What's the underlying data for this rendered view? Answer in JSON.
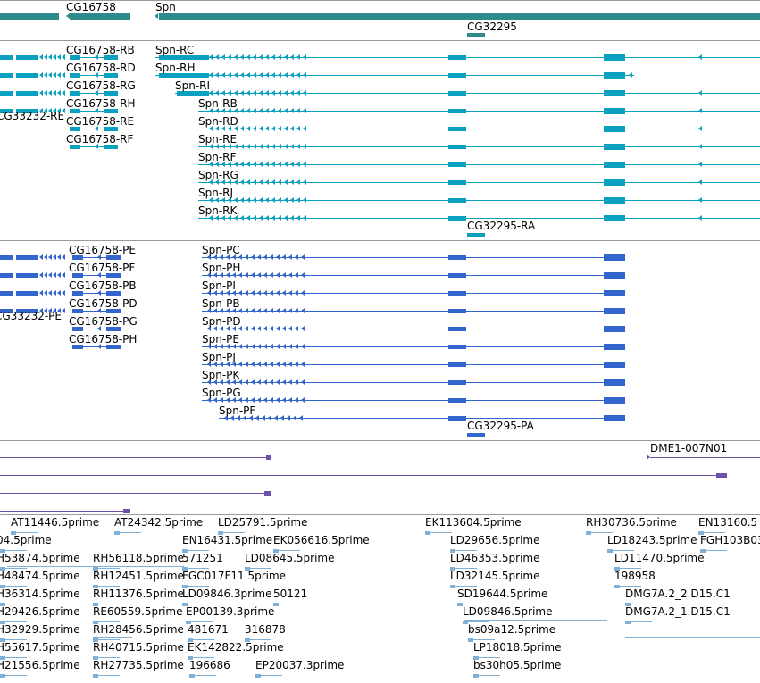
{
  "colors": {
    "gene": "#2e8b8b",
    "transcript": "#0aa1c0",
    "protein": "#3366cc",
    "cdna": "#6b52a8",
    "est": "#7eb0d8",
    "separator": "#9a9a9a"
  },
  "genes": {
    "cg16758": "CG16758",
    "spn": "Spn",
    "cg32295": "CG32295"
  },
  "transcripts": {
    "cg16758": [
      "CG16758-RB",
      "CG16758-RD",
      "CG16758-RG",
      "CG16758-RH",
      "CG16758-RE",
      "CG16758-RF"
    ],
    "cg33232": "CG33232-RE",
    "spn": [
      "Spn-RC",
      "Spn-RH",
      "Spn-RI",
      "Spn-RB",
      "Spn-RD",
      "Spn-RE",
      "Spn-RF",
      "Spn-RG",
      "Spn-RJ",
      "Spn-RK"
    ],
    "cg32295": "CG32295-RA"
  },
  "proteins": {
    "cg16758": [
      "CG16758-PE",
      "CG16758-PF",
      "CG16758-PB",
      "CG16758-PD",
      "CG16758-PG",
      "CG16758-PH"
    ],
    "cg33232": "CG33232-PE",
    "spn": [
      "Spn-PC",
      "Spn-PH",
      "Spn-PI",
      "Spn-PB",
      "Spn-PD",
      "Spn-PE",
      "Spn-PJ",
      "Spn-PK",
      "Spn-PG",
      "Spn-PF"
    ],
    "cg32295": "CG32295-PA"
  },
  "cdna": {
    "label": "DME1-007N01"
  },
  "ests": [
    "AT11446.5prime",
    "AT24342.5prime",
    "LD25791.5prime",
    "EK113604.5prime",
    "RH30736.5prime",
    "EN13160.5",
    "04.5prime",
    "EN16431.5prime",
    "EK056616.5prime",
    "LD29656.5prime",
    "LD18243.5prime",
    "FGH103B03",
    "H53874.5prime",
    "RH56118.5prime",
    "571251",
    "LD08645.5prime",
    "LD46353.5prime",
    "LD11470.5prime",
    "H48474.5prime",
    "RH12451.5prime",
    "FGC017F11.5prime",
    "LD32145.5prime",
    "198958",
    "H36314.5prime",
    "RH11376.5prime",
    "LD09846.3prime",
    "50121",
    "SD19644.5prime",
    "DMG7A.2_2.D15.C1",
    "H29426.5prime",
    "RE60559.5prime",
    "EP00139.3prime",
    "LD09846.5prime",
    "DMG7A.2_1.D15.C1",
    "H32929.5prime",
    "RH28456.5prime",
    "481671",
    "316878",
    "bs09a12.5prime",
    "H55617.5prime",
    "RH40715.5prime",
    "EK142822.5prime",
    "LP18018.5prime",
    "H21556.5prime",
    "RH27735.5prime",
    "196686",
    "EP20037.3prime",
    "bs30h05.5prime"
  ]
}
